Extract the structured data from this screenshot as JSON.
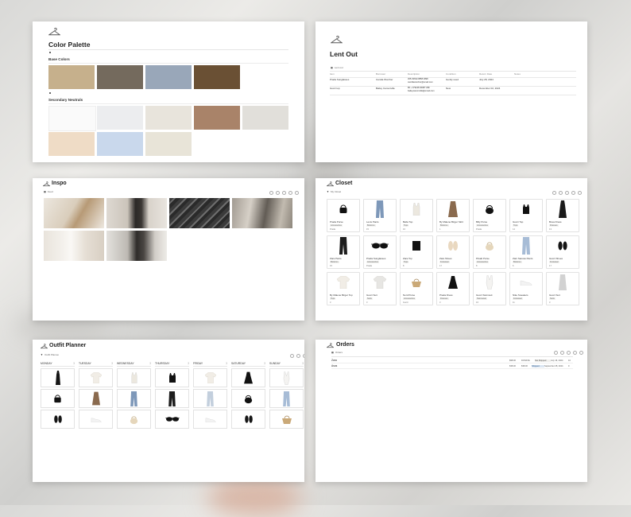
{
  "background": {
    "colors": [
      "#d9d9d7",
      "#ecebe8",
      "#cfcfcd"
    ]
  },
  "color_palette": {
    "title": "Color Palette",
    "base_label": "Base Colors",
    "base_colors": [
      "#c6b08c",
      "#746a5d",
      "#99a7b9",
      "#6a5034"
    ],
    "secondary_label": "Secondary Neutrals",
    "secondary_colors": [
      "#fafafa",
      "#ecedef",
      "#e8e4dc",
      "#a98369",
      "#e1dfda",
      "#efdcc6",
      "#c9d8ec",
      "#e8e4d8"
    ]
  },
  "lent_out": {
    "title": "Lent Out",
    "view_label": "Lent out",
    "columns": [
      "Item",
      "Borrower",
      "Description",
      "Condition",
      "Return Date",
      "Notes"
    ],
    "rows": [
      {
        "item": "Prada Sunglasses",
        "borrower": "Camila Worcher",
        "description": "305-63632-8858 2898 camillaworcher@email.com",
        "condition": "Gently used",
        "return": "July 28, 2024",
        "notes": ""
      },
      {
        "item": "Gucci top",
        "borrower": "Bailey Camonville",
        "description": "86 + 379248 06087 298 baileycamonville@email.com",
        "condition": "New",
        "return": "December 02, 2024",
        "notes": ""
      }
    ]
  },
  "inspo": {
    "title": "Inspo",
    "view_label": "Feed"
  },
  "closet": {
    "title": "Closet",
    "view_label": "My Closet",
    "items": [
      {
        "name": "Prada Purse",
        "category": "Accessories",
        "count": "Prada"
      },
      {
        "name": "Levis Pants",
        "category": "Bottoms",
        "count": "15"
      },
      {
        "name": "Bella Top",
        "category": "Tops",
        "count": "16"
      },
      {
        "name": "By Malene Birger Skirt",
        "category": "Bottoms",
        "count": "1"
      },
      {
        "name": "Billy Purse",
        "category": "Accessories",
        "count": "Prada"
      },
      {
        "name": "Gucci Top",
        "category": "Tops",
        "count": "14"
      },
      {
        "name": "Bova Dress",
        "category": "Dresses",
        "count": "13"
      },
      {
        "name": "Zara Pants",
        "category": "Bottoms",
        "count": "15"
      },
      {
        "name": "Prada Sunglasses",
        "category": "Accessories",
        "count": "Prada"
      },
      {
        "name": "Zara Top",
        "category": "Tops",
        "count": "8"
      },
      {
        "name": "Zara Shoes",
        "category": "Footwear",
        "count": "17"
      },
      {
        "name": "Pinaki Purse",
        "category": "Accessories",
        "count": "8"
      },
      {
        "name": "Zant Sancas Pants",
        "category": "Bottoms",
        "count": "6"
      },
      {
        "name": "Gucci Shoes",
        "category": "Footwear",
        "count": "17"
      },
      {
        "name": "By Malene Birger Top",
        "category": "Tops",
        "count": "3"
      },
      {
        "name": "Gucci Suit",
        "category": "Suits",
        "count": "3"
      },
      {
        "name": "Nord Purse",
        "category": "Accessories",
        "count": "Gucci"
      },
      {
        "name": "Prada Dress",
        "category": "Dresses",
        "count": "3"
      },
      {
        "name": "Gucci Swimsuit",
        "category": "Swimwear",
        "count": "16"
      },
      {
        "name": "Nike Sneakers",
        "category": "Footwear",
        "count": "11"
      },
      {
        "name": "Gucci Suit",
        "category": "Suits",
        "count": "3"
      }
    ]
  },
  "outfit_planner": {
    "title": "Outfit Planner",
    "view_label": "Outfit Planner",
    "days": [
      "MONDAY",
      "TUESDAY",
      "WEDNESDAY",
      "THURSDAY",
      "FRIDAY",
      "SATURDAY",
      "SUNDAY"
    ]
  },
  "orders": {
    "title": "Orders",
    "view_label": "Orders",
    "rows": [
      {
        "name": "Zara",
        "amount": "$98.00",
        "status": "DONATE",
        "shipping": "Not Shipped",
        "date": "July 16, 2024",
        "n": "10"
      },
      {
        "name": "Asos",
        "amount": "$38.00",
        "status": "$38.00",
        "shipping": "Shipped",
        "date": "September 28, 2024",
        "n": "9"
      }
    ]
  }
}
